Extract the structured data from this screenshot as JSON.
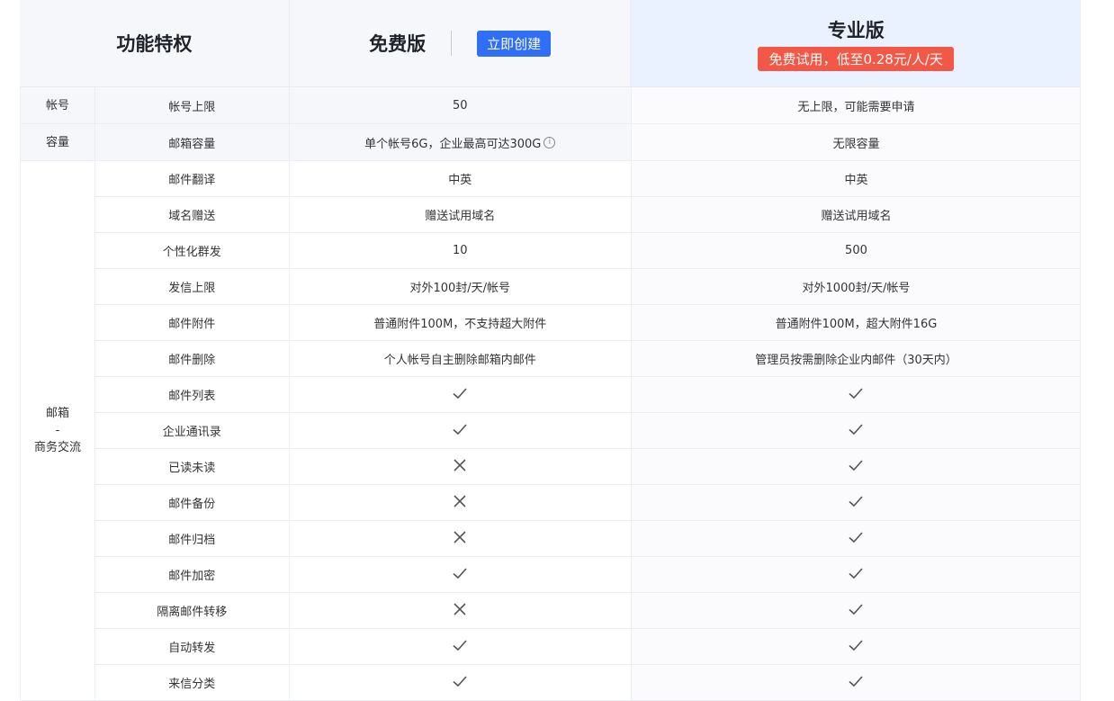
{
  "header": {
    "feature_title": "功能特权",
    "free_title": "免费版",
    "create_button": "立即创建",
    "pro_title": "专业版",
    "pro_promo": "免费试用，低至0.28元/人/天"
  },
  "groups": [
    {
      "label_line1": "帐号",
      "label_line2": "",
      "label_line3": ""
    },
    {
      "label_line1": "容量",
      "label_line2": "",
      "label_line3": ""
    },
    {
      "label_line1": "邮箱",
      "label_line2": "-",
      "label_line3": "商务交流"
    }
  ],
  "rows": [
    {
      "feature": "帐号上限",
      "free": "50",
      "pro": "无上限，可能需要申请"
    },
    {
      "feature": "邮箱容量",
      "free": "单个帐号6G，企业最高可达300G",
      "pro": "无限容量"
    },
    {
      "feature": "邮件翻译",
      "free": "中英",
      "pro": "中英"
    },
    {
      "feature": "域名赠送",
      "free": "赠送试用域名",
      "pro": "赠送试用域名"
    },
    {
      "feature": "个性化群发",
      "free": "10",
      "pro": "500"
    },
    {
      "feature": "发信上限",
      "free": "对外100封/天/帐号",
      "pro": "对外1000封/天/帐号"
    },
    {
      "feature": "邮件附件",
      "free": "普通附件100M，不支持超大附件",
      "pro": "普通附件100M，超大附件16G"
    },
    {
      "feature": "邮件删除",
      "free": "个人帐号自主删除邮箱内邮件",
      "pro": "管理员按需删除企业内邮件（30天内）"
    },
    {
      "feature": "邮件列表",
      "free_icon": "check-icon",
      "pro_icon": "check-icon"
    },
    {
      "feature": "企业通讯录",
      "free_icon": "check-icon",
      "pro_icon": "check-icon"
    },
    {
      "feature": "已读未读",
      "free_icon": "cross-icon",
      "pro_icon": "check-icon"
    },
    {
      "feature": "邮件备份",
      "free_icon": "cross-icon",
      "pro_icon": "check-icon"
    },
    {
      "feature": "邮件归档",
      "free_icon": "cross-icon",
      "pro_icon": "check-icon"
    },
    {
      "feature": "邮件加密",
      "free_icon": "check-icon",
      "pro_icon": "check-icon"
    },
    {
      "feature": "隔离邮件转移",
      "free_icon": "cross-icon",
      "pro_icon": "check-icon"
    },
    {
      "feature": "自动转发",
      "free_icon": "check-icon",
      "pro_icon": "check-icon"
    },
    {
      "feature": "来信分类",
      "free_icon": "check-icon",
      "pro_icon": "check-icon"
    }
  ],
  "colors": {
    "create_button": "#2f6ef5",
    "promo_badge": "#f25845",
    "pro_header_bg": "#eaf1ff"
  }
}
